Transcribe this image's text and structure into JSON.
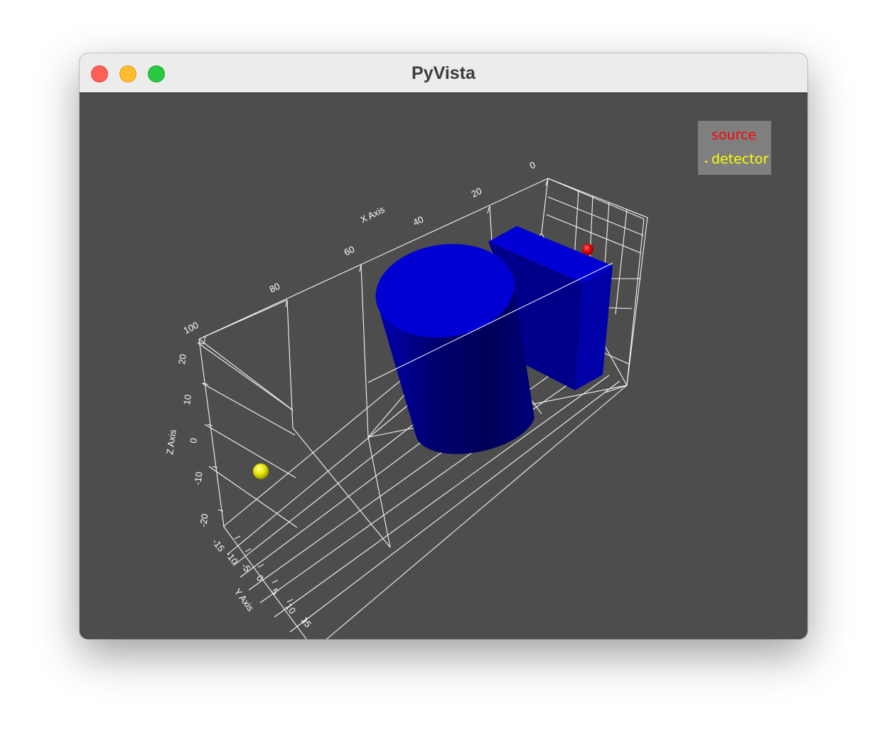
{
  "window": {
    "title": "PyVista"
  },
  "legend": {
    "items": [
      {
        "label": "source",
        "color": "#ff0000"
      },
      {
        "label": "detector",
        "color": "#ffff00"
      }
    ]
  },
  "axes": {
    "x_title": "X Axis",
    "y_title": "Y Axis",
    "z_title": "Z Axis",
    "x_ticks": [
      "0",
      "20",
      "40",
      "60",
      "80",
      "100"
    ],
    "y_ticks": [
      "-15",
      "-10",
      "-5",
      "0",
      "5",
      "10",
      "15"
    ],
    "z_ticks": [
      "20",
      "10",
      "0",
      "-10",
      "-20"
    ]
  },
  "colors": {
    "background": "#4d4d4d",
    "geometry": "#0000cc",
    "grid": "#ffffff",
    "source": "#ff0000",
    "detector": "#ffff00",
    "legend_bg": "#7f7f7f"
  }
}
